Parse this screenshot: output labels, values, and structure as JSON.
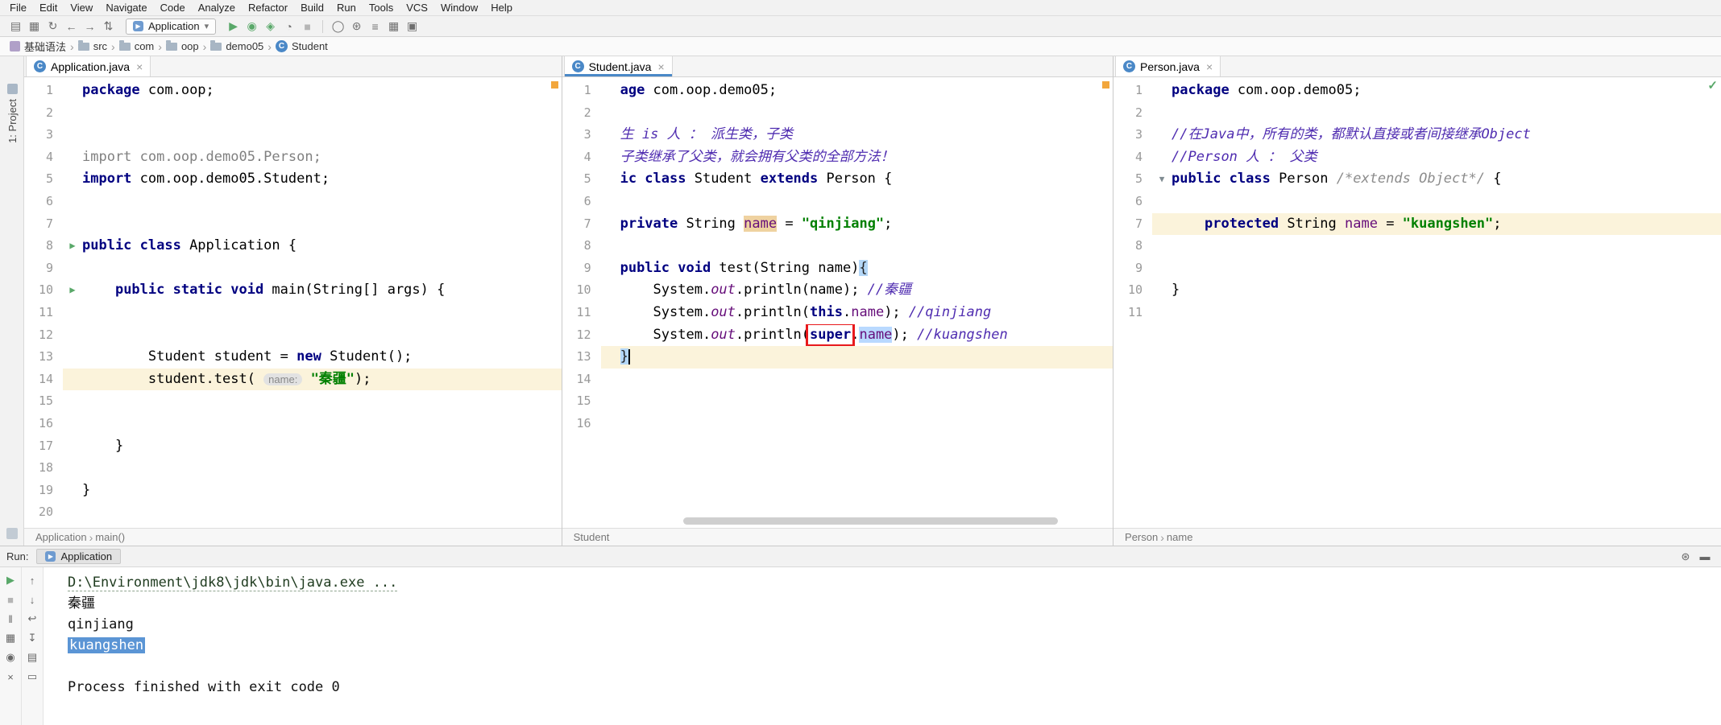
{
  "colors": {
    "keyword": "#000080",
    "string": "#008000",
    "comment": "#4F2CB0",
    "field": "#660E7A",
    "run_green": "#59A869",
    "red_box": "#E8191C",
    "current_line": "#FBF3DB",
    "selection_blue": "#5B95D5",
    "change_marker_orange": "#F2A63C"
  },
  "menu": {
    "items": [
      "File",
      "Edit",
      "View",
      "Navigate",
      "Code",
      "Analyze",
      "Refactor",
      "Build",
      "Run",
      "Tools",
      "VCS",
      "Window",
      "Help"
    ]
  },
  "toolbar": {
    "run_config": "Application",
    "left_icons": [
      {
        "name": "open-icon",
        "glyph": "▤"
      },
      {
        "name": "save-all-icon",
        "glyph": "▦"
      },
      {
        "name": "sync-icon",
        "glyph": "↻"
      },
      {
        "name": "back-icon",
        "glyph": "←"
      },
      {
        "name": "forward-icon",
        "glyph": "→"
      },
      {
        "name": "update-project-icon",
        "glyph": "⇅"
      }
    ],
    "run_icons": [
      {
        "name": "run-icon",
        "glyph": "▶",
        "color": "#59A869"
      },
      {
        "name": "debug-icon",
        "glyph": "◉",
        "color": "#59A869"
      },
      {
        "name": "coverage-icon",
        "glyph": "◈",
        "color": "#59A869"
      },
      {
        "name": "profiler-icon",
        "glyph": "◔",
        "color": "#777777"
      },
      {
        "name": "stop-icon",
        "glyph": "■",
        "color": "#B5B5B5"
      }
    ],
    "right_icons": [
      {
        "name": "search-icon",
        "glyph": "◯"
      },
      {
        "name": "settings-icon",
        "glyph": "⊛"
      },
      {
        "name": "project-structure-icon",
        "glyph": "≡"
      },
      {
        "name": "grid-icon",
        "glyph": "▦"
      },
      {
        "name": "terminal-icon",
        "glyph": "▣"
      }
    ]
  },
  "breadcrumb": {
    "items": [
      {
        "label": "基础语法",
        "icon": "project"
      },
      {
        "label": "src",
        "icon": "folder"
      },
      {
        "label": "com",
        "icon": "folder"
      },
      {
        "label": "oop",
        "icon": "folder"
      },
      {
        "label": "demo05",
        "icon": "folder"
      },
      {
        "label": "Student",
        "icon": "class"
      }
    ]
  },
  "tool_strip": {
    "project_label": "1: Project"
  },
  "panes": [
    {
      "dom": "pane-left",
      "tab": "Application.java",
      "focused": false,
      "line_count": 20,
      "marker": "orange",
      "hscroll": false,
      "breadcrumb": [
        "Application",
        "main()"
      ],
      "lines": [
        {
          "n": 1,
          "seg": [
            [
              "k",
              "package"
            ],
            [
              "p",
              " com.oop;"
            ]
          ]
        },
        {
          "n": 4,
          "seg": [
            [
              "g",
              "import com.oop.demo05.Person;"
            ]
          ]
        },
        {
          "n": 5,
          "seg": [
            [
              "k",
              "import"
            ],
            [
              "p",
              " com.oop.demo05.Student;"
            ]
          ]
        },
        {
          "n": 8,
          "icon": "run",
          "seg": [
            [
              "k",
              "public class"
            ],
            [
              "p",
              " Application {"
            ]
          ]
        },
        {
          "n": 10,
          "icon": "run",
          "seg": [
            [
              "p",
              "    "
            ],
            [
              "k",
              "public static void"
            ],
            [
              "p",
              " main(String[] args) {"
            ]
          ]
        },
        {
          "n": 13,
          "seg": [
            [
              "p",
              "        Student student = "
            ],
            [
              "k",
              "new"
            ],
            [
              "p",
              " Student();"
            ]
          ]
        },
        {
          "n": 14,
          "cur": true,
          "seg": [
            [
              "p",
              "        student.test( "
            ],
            [
              "hint",
              "name:"
            ],
            [
              "p",
              " "
            ],
            [
              "s",
              "\"秦疆\""
            ],
            [
              "p",
              ");"
            ]
          ]
        },
        {
          "n": 17,
          "seg": [
            [
              "p",
              "    }"
            ]
          ]
        },
        {
          "n": 19,
          "seg": [
            [
              "p",
              "}"
            ]
          ]
        }
      ]
    },
    {
      "dom": "pane-middle",
      "tab": "Student.java",
      "focused": true,
      "line_count": 16,
      "marker": "orange",
      "hscroll": true,
      "breadcrumb": [
        "Student"
      ],
      "lines": [
        {
          "n": 1,
          "seg": [
            [
              "k",
              "age"
            ],
            [
              "p",
              " com.oop.demo05;"
            ]
          ]
        },
        {
          "n": 3,
          "seg": [
            [
              "c",
              "生 is 人 ： 派生类，子类"
            ]
          ]
        },
        {
          "n": 4,
          "seg": [
            [
              "c",
              "子类继承了父类，就会拥有父类的全部方法！"
            ]
          ]
        },
        {
          "n": 5,
          "seg": [
            [
              "k",
              "ic class"
            ],
            [
              "p",
              " Student "
            ],
            [
              "k",
              "extends"
            ],
            [
              "p",
              " Person {"
            ]
          ]
        },
        {
          "n": 7,
          "seg": [
            [
              "k",
              "private"
            ],
            [
              "p",
              " String "
            ],
            [
              "f tan",
              "name"
            ],
            [
              "p",
              " = "
            ],
            [
              "s",
              "\"qinjiang\""
            ],
            [
              "p",
              ";"
            ]
          ]
        },
        {
          "n": 9,
          "seg": [
            [
              "k",
              "public void"
            ],
            [
              "p",
              " test(String name)"
            ],
            [
              "brace",
              "{"
            ]
          ]
        },
        {
          "n": 10,
          "seg": [
            [
              "p",
              "    System."
            ],
            [
              "st",
              "out"
            ],
            [
              "p",
              ".println(name); "
            ],
            [
              "c",
              "//秦疆"
            ]
          ]
        },
        {
          "n": 11,
          "seg": [
            [
              "p",
              "    System."
            ],
            [
              "st",
              "out"
            ],
            [
              "p",
              ".println("
            ],
            [
              "k",
              "this"
            ],
            [
              "p",
              "."
            ],
            [
              "f",
              "name"
            ],
            [
              "p",
              "); "
            ],
            [
              "c",
              "//qinjiang"
            ]
          ]
        },
        {
          "n": 12,
          "seg": [
            [
              "p",
              "    System."
            ],
            [
              "st",
              "out"
            ],
            [
              "p",
              ".println("
            ],
            [
              "k box",
              "super"
            ],
            [
              "p",
              "."
            ],
            [
              "f blue",
              "name"
            ],
            [
              "p",
              "); "
            ],
            [
              "c",
              "//kuangshen"
            ]
          ]
        },
        {
          "n": 13,
          "cur": true,
          "seg": [
            [
              "brace",
              "}"
            ],
            [
              "caret",
              ""
            ]
          ]
        }
      ]
    },
    {
      "dom": "pane-right",
      "tab": "Person.java",
      "focused": false,
      "line_count": 11,
      "marker": "check",
      "hscroll": false,
      "breadcrumb": [
        "Person",
        "name"
      ],
      "lines": [
        {
          "n": 1,
          "seg": [
            [
              "k",
              "package"
            ],
            [
              "p",
              " com.oop.demo05;"
            ]
          ]
        },
        {
          "n": 3,
          "seg": [
            [
              "c",
              "//在Java中，所有的类，都默认直接或者间接继承Object"
            ]
          ]
        },
        {
          "n": 4,
          "seg": [
            [
              "c",
              "//Person 人 ： 父类"
            ]
          ]
        },
        {
          "n": 5,
          "icon": "subclassed",
          "seg": [
            [
              "k",
              "public class"
            ],
            [
              "p",
              " Person "
            ],
            [
              "bc",
              "/*extends Object*/"
            ],
            [
              "p",
              " {"
            ]
          ]
        },
        {
          "n": 7,
          "cur": true,
          "seg": [
            [
              "p",
              "    "
            ],
            [
              "k",
              "protected"
            ],
            [
              "p",
              " String "
            ],
            [
              "f",
              "name"
            ],
            [
              "p",
              " = "
            ],
            [
              "s",
              "\"kuangshen\""
            ],
            [
              "p",
              ";"
            ]
          ]
        },
        {
          "n": 10,
          "seg": [
            [
              "p",
              "}"
            ]
          ]
        }
      ]
    }
  ],
  "run_panel": {
    "label": "Run:",
    "tab": "Application",
    "header_icons": [
      {
        "name": "settings-gear-icon",
        "glyph": "⊛"
      },
      {
        "name": "hide-panel-icon",
        "glyph": "▬"
      }
    ],
    "col1_icons": [
      {
        "name": "rerun-icon",
        "glyph": "▶",
        "color": "#59A869"
      },
      {
        "name": "stop-icon",
        "glyph": "■",
        "color": "#B5B5B5"
      },
      {
        "name": "pause-icon",
        "glyph": "‖"
      },
      {
        "name": "restore-layout-icon",
        "glyph": "▦"
      },
      {
        "name": "pin-icon",
        "glyph": "◉"
      },
      {
        "name": "close-icon",
        "glyph": "×"
      }
    ],
    "col2_icons": [
      {
        "name": "up-stack-icon",
        "glyph": "↑"
      },
      {
        "name": "down-stack-icon",
        "glyph": "↓"
      },
      {
        "name": "softwrap-icon",
        "glyph": "↩"
      },
      {
        "name": "scroll-end-icon",
        "glyph": "↧"
      },
      {
        "name": "print-icon",
        "glyph": "▤"
      },
      {
        "name": "clear-all-icon",
        "glyph": "▭"
      }
    ],
    "console": [
      {
        "style": "cmd",
        "text": "D:\\Environment\\jdk8\\jdk\\bin\\java.exe ..."
      },
      {
        "style": "out",
        "text": "秦疆"
      },
      {
        "style": "out",
        "text": "qinjiang"
      },
      {
        "style": "sel",
        "text": "kuangshen"
      },
      {
        "style": "out",
        "text": ""
      },
      {
        "style": "out",
        "text": "Process finished with exit code 0"
      }
    ]
  }
}
